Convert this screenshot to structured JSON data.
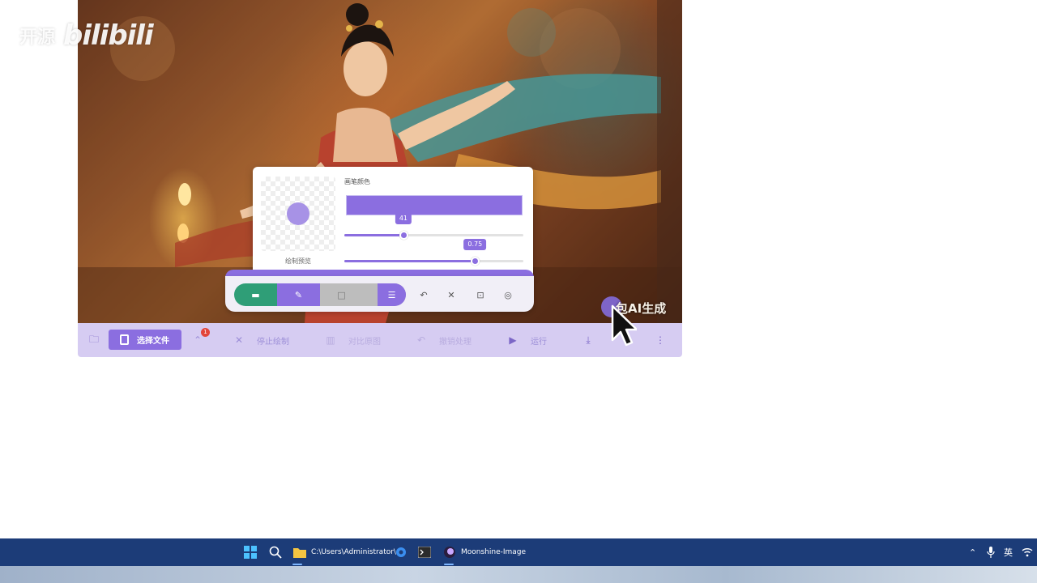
{
  "watermark": {
    "text": "开源",
    "logo": "bilibili"
  },
  "brush_panel": {
    "preview_label": "绘制预览",
    "color_label": "画笔颜色",
    "brush_color": "#8b6ee0",
    "size_slider": {
      "value": 41,
      "label": "41",
      "fraction": 0.33
    },
    "opacity_slider": {
      "value": 0.75,
      "label": "0.75",
      "fraction": 0.73
    }
  },
  "tool_bar": {
    "modes": [
      {
        "name": "pill-icon",
        "glyph": "▬"
      },
      {
        "name": "brush-icon",
        "glyph": "✎"
      },
      {
        "name": "rectangle-icon",
        "glyph": "□"
      },
      {
        "name": "eraser-icon",
        "glyph": "◆"
      }
    ],
    "settings_glyph": "☰",
    "undo_glyph": "↶",
    "close_glyph": "✕",
    "focus_glyph": "⊡",
    "hide_glyph": "◎"
  },
  "ai_badge": {
    "text": "包AI生成"
  },
  "action_bar": {
    "folder_glyph": "🗀",
    "select_file": "选择文件",
    "notification_count": "1",
    "stop_draw": "停止绘制",
    "compare": "对比原图",
    "undo": "撤销处理",
    "run": "运行",
    "download_glyph": "⤓",
    "more_glyph": "⋮"
  },
  "taskbar": {
    "explorer_label": "C:\\Users\\Administrator\\",
    "app_label": "Moonshine-Image",
    "ime_label": "英"
  }
}
